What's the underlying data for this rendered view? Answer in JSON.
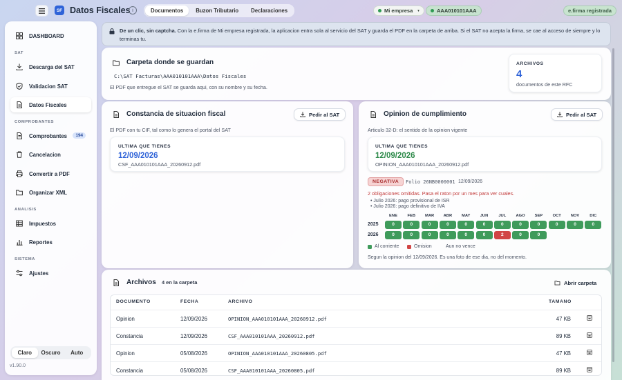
{
  "app": {
    "title": "Datos Fiscales",
    "logo": "SF"
  },
  "tabs": [
    "Documentos",
    "Buzon Tributario",
    "Declaraciones"
  ],
  "header": {
    "company": "Mi empresa",
    "rfc": "AAA010101AAA",
    "efirma": "e.firma registrada"
  },
  "sidebar": {
    "dashboard": "DASHBOARD",
    "sections": {
      "sat": "SAT",
      "comprobantes": "COMPROBANTES",
      "analisis": "ANALISIS",
      "sistema": "SISTEMA"
    },
    "items": {
      "descarga": "Descarga del SAT",
      "validacion": "Validacion SAT",
      "datos": "Datos Fiscales",
      "comprobantes": "Comprobantes",
      "comprobantes_badge": "194",
      "cancelacion": "Cancelacion",
      "convertir": "Convertir a PDF",
      "organizar": "Organizar XML",
      "impuestos": "Impuestos",
      "reportes": "Reportes",
      "ajustes": "Ajustes"
    },
    "theme": [
      "Claro",
      "Oscuro",
      "Auto"
    ],
    "version": "v1.90.0"
  },
  "banner": {
    "bold": "De un clic, sin captcha.",
    "text": "Con la e.firma de Mi empresa registrada, la aplicacion entra sola al servicio del SAT y guarda el PDF en la carpeta de arriba. Si el SAT no acepta la firma, se cae al acceso de siempre y lo terminas tu."
  },
  "folder": {
    "title": "Carpeta donde se guardan",
    "path": "C:\\SAT Facturas\\AAA010101AAA\\Datos Fiscales",
    "note": "El PDF que entregue el SAT se guarda aqui, con su nombre y su fecha.",
    "archivos_label": "ARCHIVOS",
    "archivos_count": "4",
    "archivos_sub": "documentos de este RFC"
  },
  "csf": {
    "title": "Constancia de situacion fiscal",
    "button": "Pedir al SAT",
    "sub": "El PDF con tu CIF, tal como lo genera el portal del SAT",
    "last_label": "ULTIMA QUE TIENES",
    "last_date": "12/09/2026",
    "last_file": "CSF_AAA010101AAA_20260912.pdf"
  },
  "opinion": {
    "title": "Opinion de cumplimiento",
    "button": "Pedir al SAT",
    "sub": "Articulo 32-D: el sentido de la opinion vigente",
    "last_label": "ULTIMA QUE TIENES",
    "last_date": "12/09/2026",
    "last_file": "OPINION_AAA010101AAA_20260912.pdf",
    "status": "NEGATIVA",
    "folio": "Folio 26NB0000001",
    "folio_date": "12/09/2026",
    "warning": "2 obligaciones omitidas. Pasa el raton por un mes para ver cuales.",
    "omissions": [
      "Julio 2026: pago provisional de ISR",
      "Julio 2026: pago definitivo de IVA"
    ],
    "months": [
      "ENE",
      "FEB",
      "MAR",
      "ABR",
      "MAY",
      "JUN",
      "JUL",
      "AGO",
      "SEP",
      "OCT",
      "NOV",
      "DIC"
    ],
    "years": [
      {
        "year": "2025",
        "values": [
          "0",
          "0",
          "0",
          "0",
          "0",
          "0",
          "0",
          "0",
          "0",
          "0",
          "0",
          "0"
        ]
      },
      {
        "year": "2026",
        "values": [
          "0",
          "0",
          "0",
          "0",
          "0",
          "0",
          "2",
          "0",
          "0",
          "",
          "",
          ""
        ]
      }
    ],
    "legend": [
      "Al corriente",
      "Omision",
      "Aun no vence"
    ],
    "footnote": "Segun la opinion del 12/09/2026. Es una foto de ese dia, no del momento.",
    "colors": {
      "ok": "#3f9b5b",
      "bad": "#d14545"
    }
  },
  "archivos": {
    "title": "Archivos",
    "count_label": "4 en la carpeta",
    "open_button": "Abrir carpeta",
    "columns": [
      "DOCUMENTO",
      "FECHA",
      "ARCHIVO",
      "TAMANO"
    ],
    "rows": [
      {
        "doc": "Opinion",
        "date": "12/09/2026",
        "file": "OPINION_AAA010101AAA_20260912.pdf",
        "size": "47 KB"
      },
      {
        "doc": "Constancia",
        "date": "12/09/2026",
        "file": "CSF_AAA010101AAA_20260912.pdf",
        "size": "89 KB"
      },
      {
        "doc": "Opinion",
        "date": "05/08/2026",
        "file": "OPINION_AAA010101AAA_20260805.pdf",
        "size": "47 KB"
      },
      {
        "doc": "Constancia",
        "date": "05/08/2026",
        "file": "CSF_AAA010101AAA_20260805.pdf",
        "size": "89 KB"
      }
    ]
  }
}
